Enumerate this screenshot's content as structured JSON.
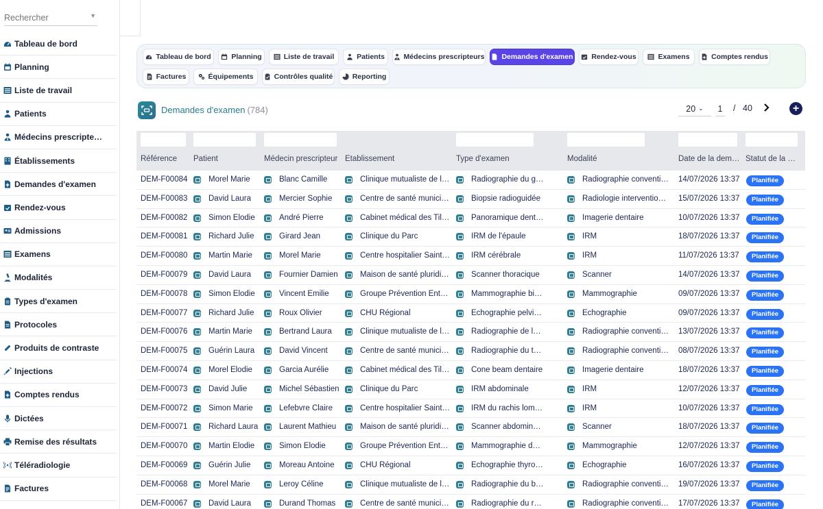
{
  "sidebar": {
    "search_placeholder": "Rechercher",
    "items": [
      {
        "label": "Tableau de bord",
        "icon": "dashboard-icon"
      },
      {
        "label": "Planning",
        "icon": "calendar-icon"
      },
      {
        "label": "Liste de travail",
        "icon": "worklist-icon"
      },
      {
        "label": "Patients",
        "icon": "patient-icon"
      },
      {
        "label": "Médecins prescripte…",
        "icon": "doctor-icon"
      },
      {
        "label": "Établissements",
        "icon": "building-icon"
      },
      {
        "label": "Demandes d'examen",
        "icon": "request-icon"
      },
      {
        "label": "Rendez-vous",
        "icon": "appointment-icon"
      },
      {
        "label": "Admissions",
        "icon": "admission-icon"
      },
      {
        "label": "Examens",
        "icon": "exam-icon"
      },
      {
        "label": "Modalités",
        "icon": "microscope-icon"
      },
      {
        "label": "Types d'examen",
        "icon": "exam-type-icon"
      },
      {
        "label": "Protocoles",
        "icon": "protocol-icon"
      },
      {
        "label": "Produits de contraste",
        "icon": "contrast-icon"
      },
      {
        "label": "Injections",
        "icon": "syringe-icon"
      },
      {
        "label": "Comptes rendus",
        "icon": "report-icon"
      },
      {
        "label": "Dictées",
        "icon": "microphone-icon"
      },
      {
        "label": "Remise des résultats",
        "icon": "printer-icon"
      },
      {
        "label": "Téléradiologie",
        "icon": "broadcast-icon"
      },
      {
        "label": "Factures",
        "icon": "invoice-icon"
      }
    ]
  },
  "tabs": [
    {
      "label": "Tableau de bord",
      "icon": "dashboard-icon",
      "active": false
    },
    {
      "label": "Planning",
      "icon": "calendar-icon",
      "active": false
    },
    {
      "label": "Liste de travail",
      "icon": "worklist-icon",
      "active": false
    },
    {
      "label": "Patients",
      "icon": "patient-icon",
      "active": false
    },
    {
      "label": "Médecins prescripteurs",
      "icon": "doctor-icon",
      "active": false
    },
    {
      "label": "Demandes d'examen",
      "icon": "request-icon",
      "active": true
    },
    {
      "label": "Rendez-vous",
      "icon": "appointment-icon",
      "active": false
    },
    {
      "label": "Examens",
      "icon": "exam-icon",
      "active": false
    },
    {
      "label": "Comptes rendus",
      "icon": "report-icon",
      "active": false
    },
    {
      "label": "Factures",
      "icon": "invoice-icon",
      "active": false
    },
    {
      "label": "Équipements",
      "icon": "gears-icon",
      "active": false
    },
    {
      "label": "Contrôles qualité",
      "icon": "quality-icon",
      "active": false
    },
    {
      "label": "Reporting",
      "icon": "chart-pie-icon",
      "active": false
    }
  ],
  "header": {
    "title": "Demandes d'examen",
    "count": "(784)",
    "per_page": "20",
    "page": "1",
    "page_sep": "/",
    "total_pages": "40"
  },
  "colors": {
    "accent": "#5b44e6",
    "badge": "#2b73f5",
    "title": "#2a7d8c"
  },
  "table": {
    "columns": [
      "Référence",
      "Patient",
      "Médecin prescripteur",
      "Établissement",
      "Type d'examen",
      "Modalité",
      "Date de la dem…",
      "Statut de la …"
    ],
    "rows": [
      [
        "DEM-F00084",
        "Morel Marie",
        "Blanc Camille",
        "Clinique mutualiste de l'…",
        "Radiographie du genou",
        "Radiographie conventio…",
        "14/07/2026 13:37",
        "Planifiée"
      ],
      [
        "DEM-F00083",
        "David Laura",
        "Mercier Sophie",
        "Centre de santé munici…",
        "Biopsie radioguidée",
        "Radiologie intervention…",
        "15/07/2026 13:37",
        "Planifiée"
      ],
      [
        "DEM-F00082",
        "Simon Élodie",
        "André Pierre",
        "Cabinet médical des Till…",
        "Panoramique dentaire",
        "Imagerie dentaire",
        "10/07/2026 13:37",
        "Planifiée"
      ],
      [
        "DEM-F00081",
        "Richard Julie",
        "Girard Jean",
        "Clinique du Parc",
        "IRM de l'épaule",
        "IRM",
        "18/07/2026 13:37",
        "Planifiée"
      ],
      [
        "DEM-F00080",
        "Martin Marie",
        "Morel Marie",
        "Centre hospitalier Saint…",
        "IRM cérébrale",
        "IRM",
        "11/07/2026 13:37",
        "Planifiée"
      ],
      [
        "DEM-F00079",
        "David Laura",
        "Fournier Damien",
        "Maison de santé pluridi…",
        "Scanner thoracique",
        "Scanner",
        "14/07/2026 13:37",
        "Planifiée"
      ],
      [
        "DEM-F00078",
        "Simon Élodie",
        "Vincent Émilie",
        "Groupe Prévention Entr…",
        "Mammographie bilatérale",
        "Mammographie",
        "09/07/2026 13:37",
        "Planifiée"
      ],
      [
        "DEM-F00077",
        "Richard Julie",
        "Roux Olivier",
        "CHU Régional",
        "Échographie pelvienne",
        "Échographie",
        "09/07/2026 13:37",
        "Planifiée"
      ],
      [
        "DEM-F00076",
        "Martin Marie",
        "Bertrand Laura",
        "Clinique mutualiste de l'…",
        "Radiographie de la main",
        "Radiographie conventio…",
        "13/07/2026 13:37",
        "Planifiée"
      ],
      [
        "DEM-F00075",
        "Guérin Laura",
        "David Vincent",
        "Centre de santé munici…",
        "Radiographie du thorax",
        "Radiographie conventio…",
        "08/07/2026 13:37",
        "Planifiée"
      ],
      [
        "DEM-F00074",
        "Morel Élodie",
        "Garcia Aurélie",
        "Cabinet médical des Till…",
        "Cone beam dentaire",
        "Imagerie dentaire",
        "18/07/2026 13:37",
        "Planifiée"
      ],
      [
        "DEM-F00073",
        "David Julie",
        "Michel Sébastien",
        "Clinique du Parc",
        "IRM abdominale",
        "IRM",
        "12/07/2026 13:37",
        "Planifiée"
      ],
      [
        "DEM-F00072",
        "Simon Marie",
        "Lefebvre Claire",
        "Centre hospitalier Saint…",
        "IRM du rachis lombaire",
        "IRM",
        "10/07/2026 13:37",
        "Planifiée"
      ],
      [
        "DEM-F00071",
        "Richard Laura",
        "Laurent Mathieu",
        "Maison de santé pluridi…",
        "Scanner abdomino-pelv…",
        "Scanner",
        "18/07/2026 13:37",
        "Planifiée"
      ],
      [
        "DEM-F00070",
        "Martin Élodie",
        "Simon Élodie",
        "Groupe Prévention Entr…",
        "Mammographie de dépi…",
        "Mammographie",
        "12/07/2026 13:37",
        "Planifiée"
      ],
      [
        "DEM-F00069",
        "Guérin Julie",
        "Moreau Antoine",
        "CHU Régional",
        "Échographie thyroïdienne",
        "Échographie",
        "16/07/2026 13:37",
        "Planifiée"
      ],
      [
        "DEM-F00068",
        "Morel Marie",
        "Leroy Céline",
        "Clinique mutualiste de l'…",
        "Radiographie du bassin",
        "Radiographie conventio…",
        "19/07/2026 13:37",
        "Planifiée"
      ],
      [
        "DEM-F00067",
        "David Laura",
        "Durand Thomas",
        "Centre de santé munici…",
        "Radiographie du rachis",
        "Radiographie conventio…",
        "17/07/2026 13:37",
        "Planifiée"
      ]
    ]
  }
}
